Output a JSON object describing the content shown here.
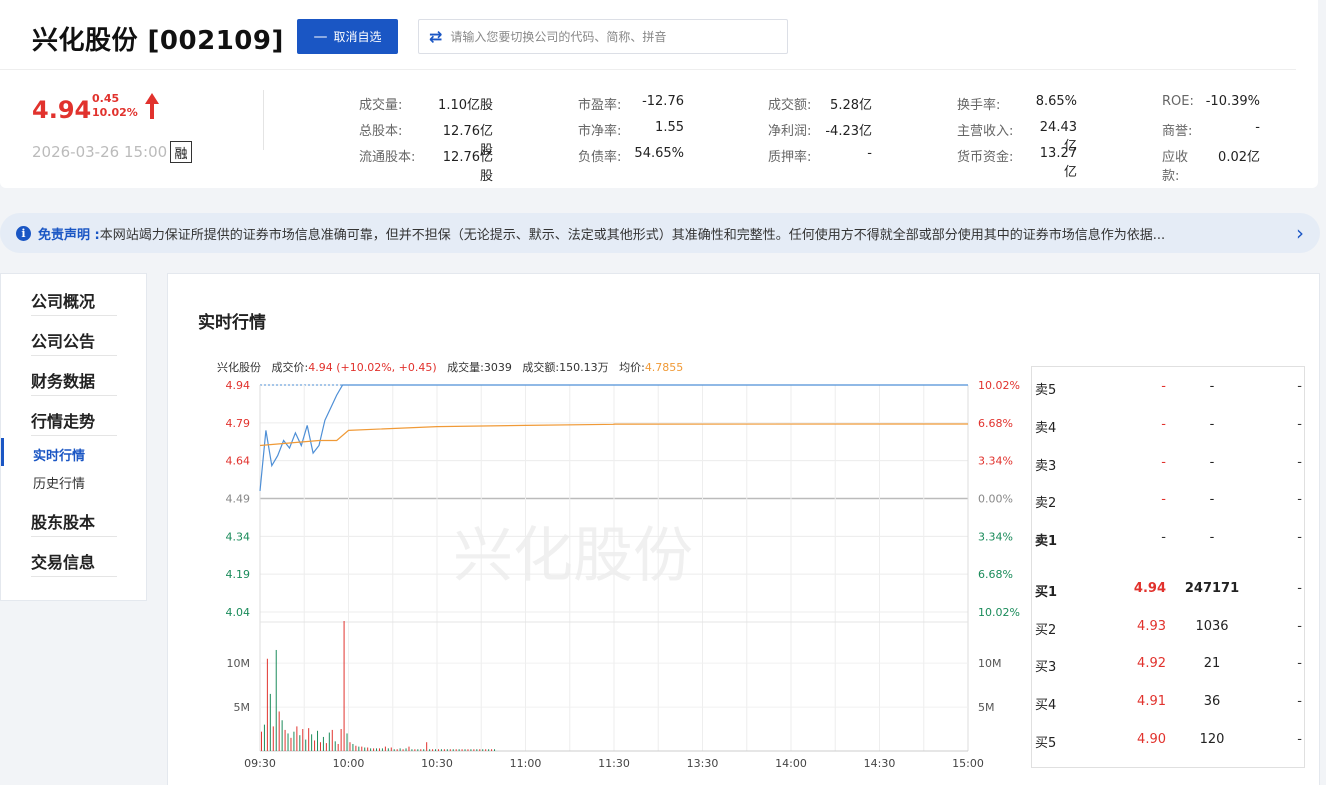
{
  "header": {
    "company_name": "兴化股份 [002109]",
    "unfollow_label": "取消自选",
    "search_placeholder": "请输入您要切换公司的代码、简称、拼音",
    "price": "4.94",
    "change_abs": "0.45",
    "change_pct": "10.02%",
    "timestamp": "2026-03-26 15:00",
    "margin_badge": "融"
  },
  "stats": [
    [
      {
        "label": "成交量:",
        "value": "1.10亿股"
      },
      {
        "label": "总股本:",
        "value": "12.76亿股"
      },
      {
        "label": "流通股本:",
        "value": "12.76亿股"
      }
    ],
    [
      {
        "label": "市盈率:",
        "value": "-12.76"
      },
      {
        "label": "市净率:",
        "value": "1.55"
      },
      {
        "label": "负债率:",
        "value": "54.65%"
      }
    ],
    [
      {
        "label": "成交额:",
        "value": "5.28亿"
      },
      {
        "label": "净利润:",
        "value": "-4.23亿"
      },
      {
        "label": "质押率:",
        "value": "-"
      }
    ],
    [
      {
        "label": "换手率:",
        "value": "8.65%"
      },
      {
        "label": "主营收入:",
        "value": "24.43亿"
      },
      {
        "label": "货币资金:",
        "value": "13.27亿"
      }
    ],
    [
      {
        "label": "ROE:",
        "value": "-10.39%"
      },
      {
        "label": "商誉:",
        "value": "-"
      },
      {
        "label": "应收款:",
        "value": "0.02亿"
      }
    ]
  ],
  "disclaimer": {
    "title": "免责声明 :",
    "text": " 本网站竭力保证所提供的证券市场信息准确可靠，但并不担保（无论提示、默示、法定或其他形式）其准确性和完整性。任何使用方不得就全部或部分使用其中的证券市场信息作为依据..."
  },
  "sidebar": {
    "items": [
      "公司概况",
      "公司公告",
      "财务数据",
      "行情走势",
      "股东股本",
      "交易信息"
    ],
    "sub_items": [
      "实时行情",
      "历史行情"
    ]
  },
  "main": {
    "section_title": "实时行情",
    "info": {
      "name": "兴化股份",
      "price_label": "成交价:",
      "price_value": "4.94 (+10.02%, +0.45)",
      "vol_label": "成交量:",
      "vol_value": "3039",
      "amt_label": "成交额:",
      "amt_value": "150.13万",
      "avg_label": "均价:",
      "avg_value": "4.7855"
    },
    "watermark": "兴化股份"
  },
  "chart_data": {
    "type": "line",
    "series": [
      {
        "name": "成交价",
        "color": "#4e8fd6",
        "x": [
          "09:30",
          "09:32",
          "09:34",
          "09:36",
          "09:38",
          "09:40",
          "09:42",
          "09:44",
          "09:46",
          "09:48",
          "09:50",
          "09:52",
          "09:54",
          "09:56",
          "09:58",
          "10:00",
          "11:30",
          "13:00",
          "15:00"
        ],
        "values": [
          4.52,
          4.76,
          4.62,
          4.66,
          4.72,
          4.69,
          4.75,
          4.7,
          4.78,
          4.67,
          4.7,
          4.8,
          4.85,
          4.9,
          4.94,
          4.94,
          4.94,
          4.94,
          4.94
        ]
      },
      {
        "name": "均价",
        "color": "#f09a37",
        "x": [
          "09:30",
          "09:40",
          "09:50",
          "09:56",
          "10:00",
          "10:30",
          "11:00",
          "11:30",
          "13:00",
          "15:00"
        ],
        "values": [
          4.7,
          4.71,
          4.72,
          4.72,
          4.76,
          4.775,
          4.78,
          4.784,
          4.785,
          4.7855
        ]
      }
    ],
    "y_left_ticks": [
      "4.94",
      "4.79",
      "4.64",
      "4.49",
      "4.34",
      "4.19",
      "4.04"
    ],
    "y_right_ticks": [
      "10.02%",
      "6.68%",
      "3.34%",
      "0.00%",
      "3.34%",
      "6.68%",
      "10.02%"
    ],
    "x_ticks": [
      "09:30",
      "10:00",
      "10:30",
      "11:00",
      "11:30",
      "13:30",
      "14:00",
      "14:30",
      "15:00"
    ],
    "ylim": [
      4.04,
      4.94
    ],
    "prev_close": 4.49,
    "volume": {
      "ticks": [
        "10M",
        "5M"
      ],
      "ylim": [
        0,
        14
      ],
      "values_million": [
        2.2,
        3.0,
        10.5,
        6.5,
        2.8,
        11.5,
        4.5,
        3.5,
        2.4,
        2.0,
        1.5,
        2.2,
        2.8,
        1.8,
        2.5,
        1.3,
        2.6,
        1.9,
        1.2,
        2.3,
        1.0,
        1.6,
        0.9,
        2.1,
        2.4,
        1.1,
        0.8,
        2.5,
        14.8,
        2.0,
        1.0,
        0.8,
        0.6,
        0.5,
        0.5,
        0.4,
        0.4,
        0.3,
        0.3,
        0.3,
        0.3,
        0.3,
        0.5,
        0.3,
        0.4,
        0.2,
        0.2,
        0.3,
        0.2,
        0.3,
        0.5,
        0.2,
        0.2,
        0.2,
        0.2,
        0.2,
        1.0,
        0.2,
        0.2,
        0.2,
        0.2,
        0.2,
        0.2,
        0.2,
        0.2,
        0.2,
        0.2,
        0.2,
        0.2,
        0.2,
        0.2,
        0.2,
        0.2,
        0.2,
        0.2,
        0.2,
        0.2,
        0.2,
        0.2,
        0.2
      ],
      "up_colors": [
        1,
        0,
        1,
        0,
        1,
        0,
        1,
        0,
        1,
        0,
        1,
        0,
        1,
        0,
        1,
        0,
        1,
        0,
        1,
        0,
        1,
        0,
        1,
        0,
        1,
        0,
        1,
        1,
        1,
        0,
        1,
        0,
        1,
        0,
        1,
        0,
        1,
        0,
        1,
        0,
        1,
        0,
        1,
        0,
        1,
        0,
        1,
        0,
        1,
        0,
        1,
        0,
        1,
        0,
        1,
        0,
        1,
        0,
        1,
        0,
        1,
        0,
        1,
        0,
        1,
        0,
        1,
        0,
        1,
        0,
        1,
        0,
        1,
        0,
        1,
        0,
        1,
        0,
        1,
        0
      ]
    }
  },
  "orderbook": {
    "sell": [
      {
        "label": "卖5",
        "price": "-",
        "vol": "-",
        "extra": "-"
      },
      {
        "label": "卖4",
        "price": "-",
        "vol": "-",
        "extra": "-"
      },
      {
        "label": "卖3",
        "price": "-",
        "vol": "-",
        "extra": "-"
      },
      {
        "label": "卖2",
        "price": "-",
        "vol": "-",
        "extra": "-"
      },
      {
        "label": "卖1",
        "price": "-",
        "vol": "-",
        "extra": "-"
      }
    ],
    "buy": [
      {
        "label": "买1",
        "price": "4.94",
        "vol": "247171",
        "extra": "-"
      },
      {
        "label": "买2",
        "price": "4.93",
        "vol": "1036",
        "extra": "-"
      },
      {
        "label": "买3",
        "price": "4.92",
        "vol": "21",
        "extra": "-"
      },
      {
        "label": "买4",
        "price": "4.91",
        "vol": "36",
        "extra": "-"
      },
      {
        "label": "买5",
        "price": "4.90",
        "vol": "120",
        "extra": "-"
      }
    ]
  },
  "colors": {
    "up": "#e1322d",
    "down": "#1a8b5a",
    "accent": "#1a56c4"
  }
}
